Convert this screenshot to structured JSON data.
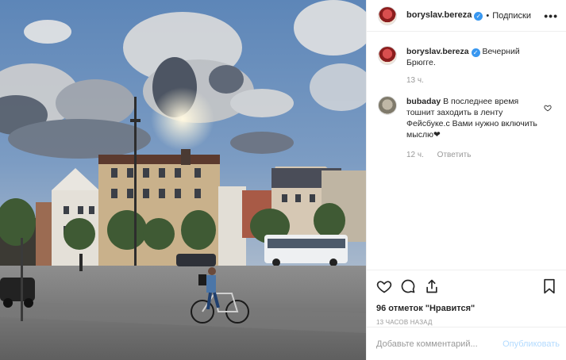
{
  "post": {
    "username": "boryslav.bereza",
    "follow_separator": "•",
    "follow_label": "Подписки",
    "more_label": "•••"
  },
  "caption": {
    "username": "boryslav.bereza",
    "text": "Вечерний Брюгге.",
    "time": "13 ч."
  },
  "comment": {
    "username": "bubaday",
    "text": "В последнее время тошнит заходить в ленту Фейсбуке.с Вами нужно включить мыслю❤",
    "time": "12 ч.",
    "reply_label": "Ответить"
  },
  "likes": "96 отметок \"Нравится\"",
  "time_ago": "13 ЧАСОВ НАЗАД",
  "add_comment": {
    "placeholder": "Добавьте комментарий...",
    "post_label": "Опубликовать"
  },
  "colors": {
    "verified": "#3897f0",
    "post_button_disabled": "#b3dbff"
  },
  "icons": [
    "heart-icon",
    "comment-icon",
    "share-icon",
    "bookmark-icon",
    "verified-icon",
    "more-icon"
  ]
}
